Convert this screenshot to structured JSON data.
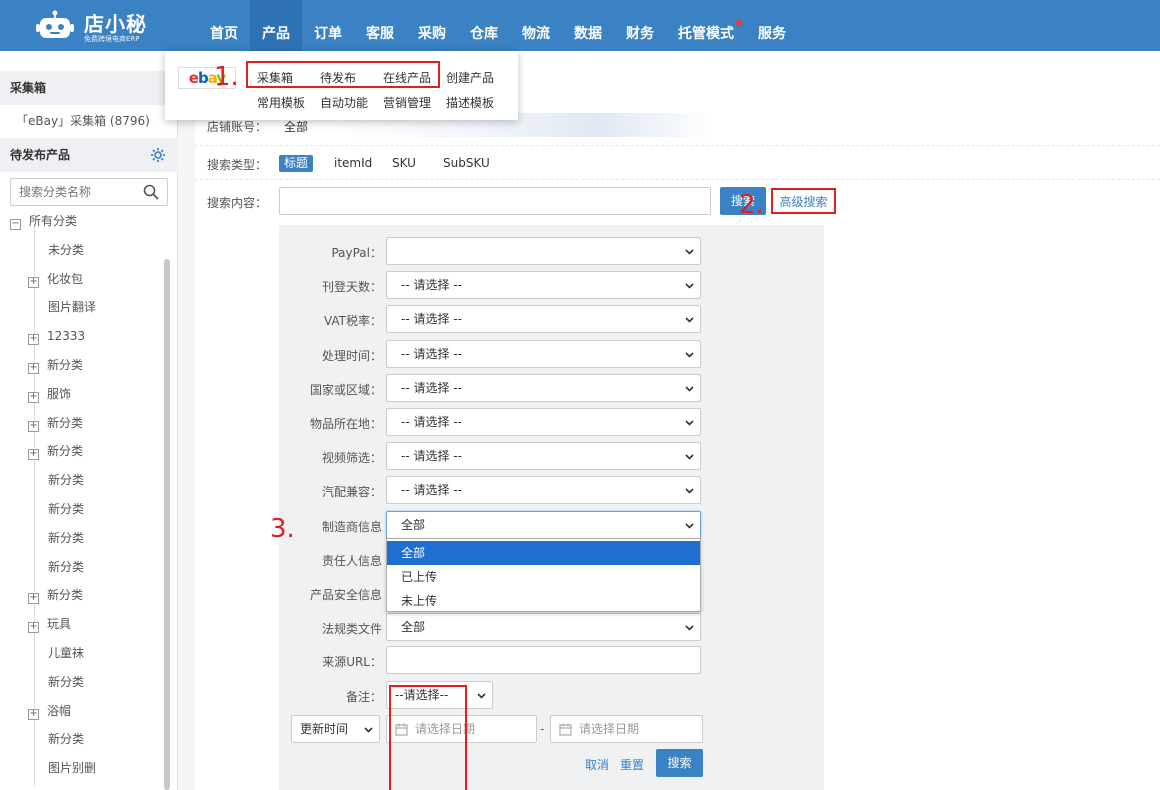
{
  "logo": {
    "brand": "店小秘",
    "slogan": "免费跨境电商ERP"
  },
  "nav": [
    "首页",
    "产品",
    "订单",
    "客服",
    "采购",
    "仓库",
    "物流",
    "数据",
    "财务",
    "托管模式",
    "服务"
  ],
  "product_menu": {
    "row1": [
      "采集箱",
      "待发布",
      "在线产品",
      "创建产品"
    ],
    "row2": [
      "常用模板",
      "自动功能",
      "营销管理",
      "描述模板"
    ]
  },
  "sidebar": {
    "box_title": "采集箱",
    "box_item": "「eBay」采集箱 (8796)",
    "pending_title": "待发布产品",
    "search_placeholder": "搜索分类名称",
    "tree": [
      {
        "label": "所有分类",
        "expand": "−",
        "level": 0
      },
      {
        "label": "未分类",
        "level": 1
      },
      {
        "label": "化妆包",
        "expand": "+",
        "level": 1
      },
      {
        "label": "图片翻译",
        "level": 1
      },
      {
        "label": "12333",
        "expand": "+",
        "level": 1
      },
      {
        "label": "新分类",
        "expand": "+",
        "level": 1
      },
      {
        "label": "服饰",
        "expand": "+",
        "level": 1
      },
      {
        "label": "新分类",
        "expand": "+",
        "level": 1
      },
      {
        "label": "新分类",
        "expand": "+",
        "level": 1
      },
      {
        "label": "新分类",
        "level": 1
      },
      {
        "label": "新分类",
        "level": 1
      },
      {
        "label": "新分类",
        "level": 1
      },
      {
        "label": "新分类",
        "level": 1
      },
      {
        "label": "新分类",
        "expand": "+",
        "level": 1
      },
      {
        "label": "玩具",
        "expand": "+",
        "level": 1
      },
      {
        "label": "儿童袜",
        "level": 1
      },
      {
        "label": "新分类",
        "level": 1
      },
      {
        "label": "浴帽",
        "expand": "+",
        "level": 1
      },
      {
        "label": "新分类",
        "level": 1
      },
      {
        "label": "图片别删",
        "level": 1
      }
    ]
  },
  "main": {
    "store_label": "店铺账号：",
    "store_value": "全部",
    "search_type_label": "搜索类型：",
    "search_types": [
      "标题",
      "itemId",
      "SKU",
      "SubSKU"
    ],
    "content_label": "搜索内容：",
    "search_button": "搜索",
    "advanced_search": "高级搜索"
  },
  "advanced": {
    "fields": [
      {
        "label": "PayPal：",
        "value": ""
      },
      {
        "label": "刊登天数：",
        "value": "-- 请选择 --"
      },
      {
        "label": "VAT税率：",
        "value": "-- 请选择 --"
      },
      {
        "label": "处理时间：",
        "value": "-- 请选择 --"
      },
      {
        "label": "国家或区域：",
        "value": "-- 请选择 --"
      },
      {
        "label": "物品所在地：",
        "value": "-- 请选择 --"
      },
      {
        "label": "视频筛选：",
        "value": "-- 请选择 --"
      },
      {
        "label": "汽配兼容：",
        "value": "-- 请选择 --"
      },
      {
        "label": "制造商信息",
        "value": "全部"
      },
      {
        "label": "责任人信息",
        "value": ""
      },
      {
        "label": "产品安全信息",
        "value": ""
      },
      {
        "label": "法规类文件",
        "value": "全部"
      }
    ],
    "dropdown_options": [
      "全部",
      "已上传",
      "未上传"
    ],
    "source_url_label": "来源URL：",
    "note_label": "备注：",
    "note_value": "--请选择--",
    "time_select": "更新时间",
    "date_placeholder": "请选择日期",
    "date_sep": "-",
    "cancel": "取消",
    "reset": "重置",
    "search": "搜索"
  },
  "annotations": [
    "1.",
    "2.",
    "3."
  ],
  "colors": {
    "primary": "#3b82c4",
    "highlight": "#e02020"
  }
}
